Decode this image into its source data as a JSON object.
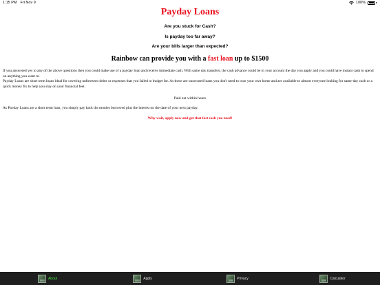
{
  "status_bar": {
    "time": "1:15 PM",
    "date": "Fri Nov 9",
    "battery": "100%",
    "battery_level": 1.0
  },
  "page": {
    "title": "Payday Loans",
    "questions": [
      "Are you stuck for Cash?",
      "Is payday too far away?",
      "Are your bills larger than expected?"
    ],
    "headline": {
      "before": "Rainbow can provide you with a ",
      "highlight": "fast loan",
      "after": " up to $1500"
    },
    "paragraph_1": "If you answered yes to any of the above questions then you could make use of a payday loan and receive immediate cash. With same day transfers, the cash advance could be in your account the day you apply and you could have instant cash to spend on anything you want to.",
    "paragraph_2": "Payday Loans are short term loans ideal for covering unforeseen debts or expenses that you failed to budget for. As these are unsecured loans you don't need to own your own home and are available to almost everyone looking for same-day cash or a quick money fix to help you stay on your financial feet.",
    "paid_out": "Paid out within hours",
    "short_term": "As Payday Loans are a short term loan, you simply pay back the monies borrowed plus the interest on the date of your next payday.",
    "cta": "Why wait, apply now and get that fast cash you need!"
  },
  "tab_bar": {
    "tabs": [
      {
        "label": "About",
        "icon": "about-icon",
        "active": true
      },
      {
        "label": "Apply",
        "icon": "apply-icon",
        "active": false
      },
      {
        "label": "Privacy",
        "icon": "privacy-icon",
        "active": false
      },
      {
        "label": "Calculator",
        "icon": "calculator-icon",
        "active": false
      }
    ]
  },
  "colors": {
    "accent_red": "#e8101e",
    "tab_bar_bg": "#1f1f1f",
    "active_tab_text": "#3fe63f"
  }
}
